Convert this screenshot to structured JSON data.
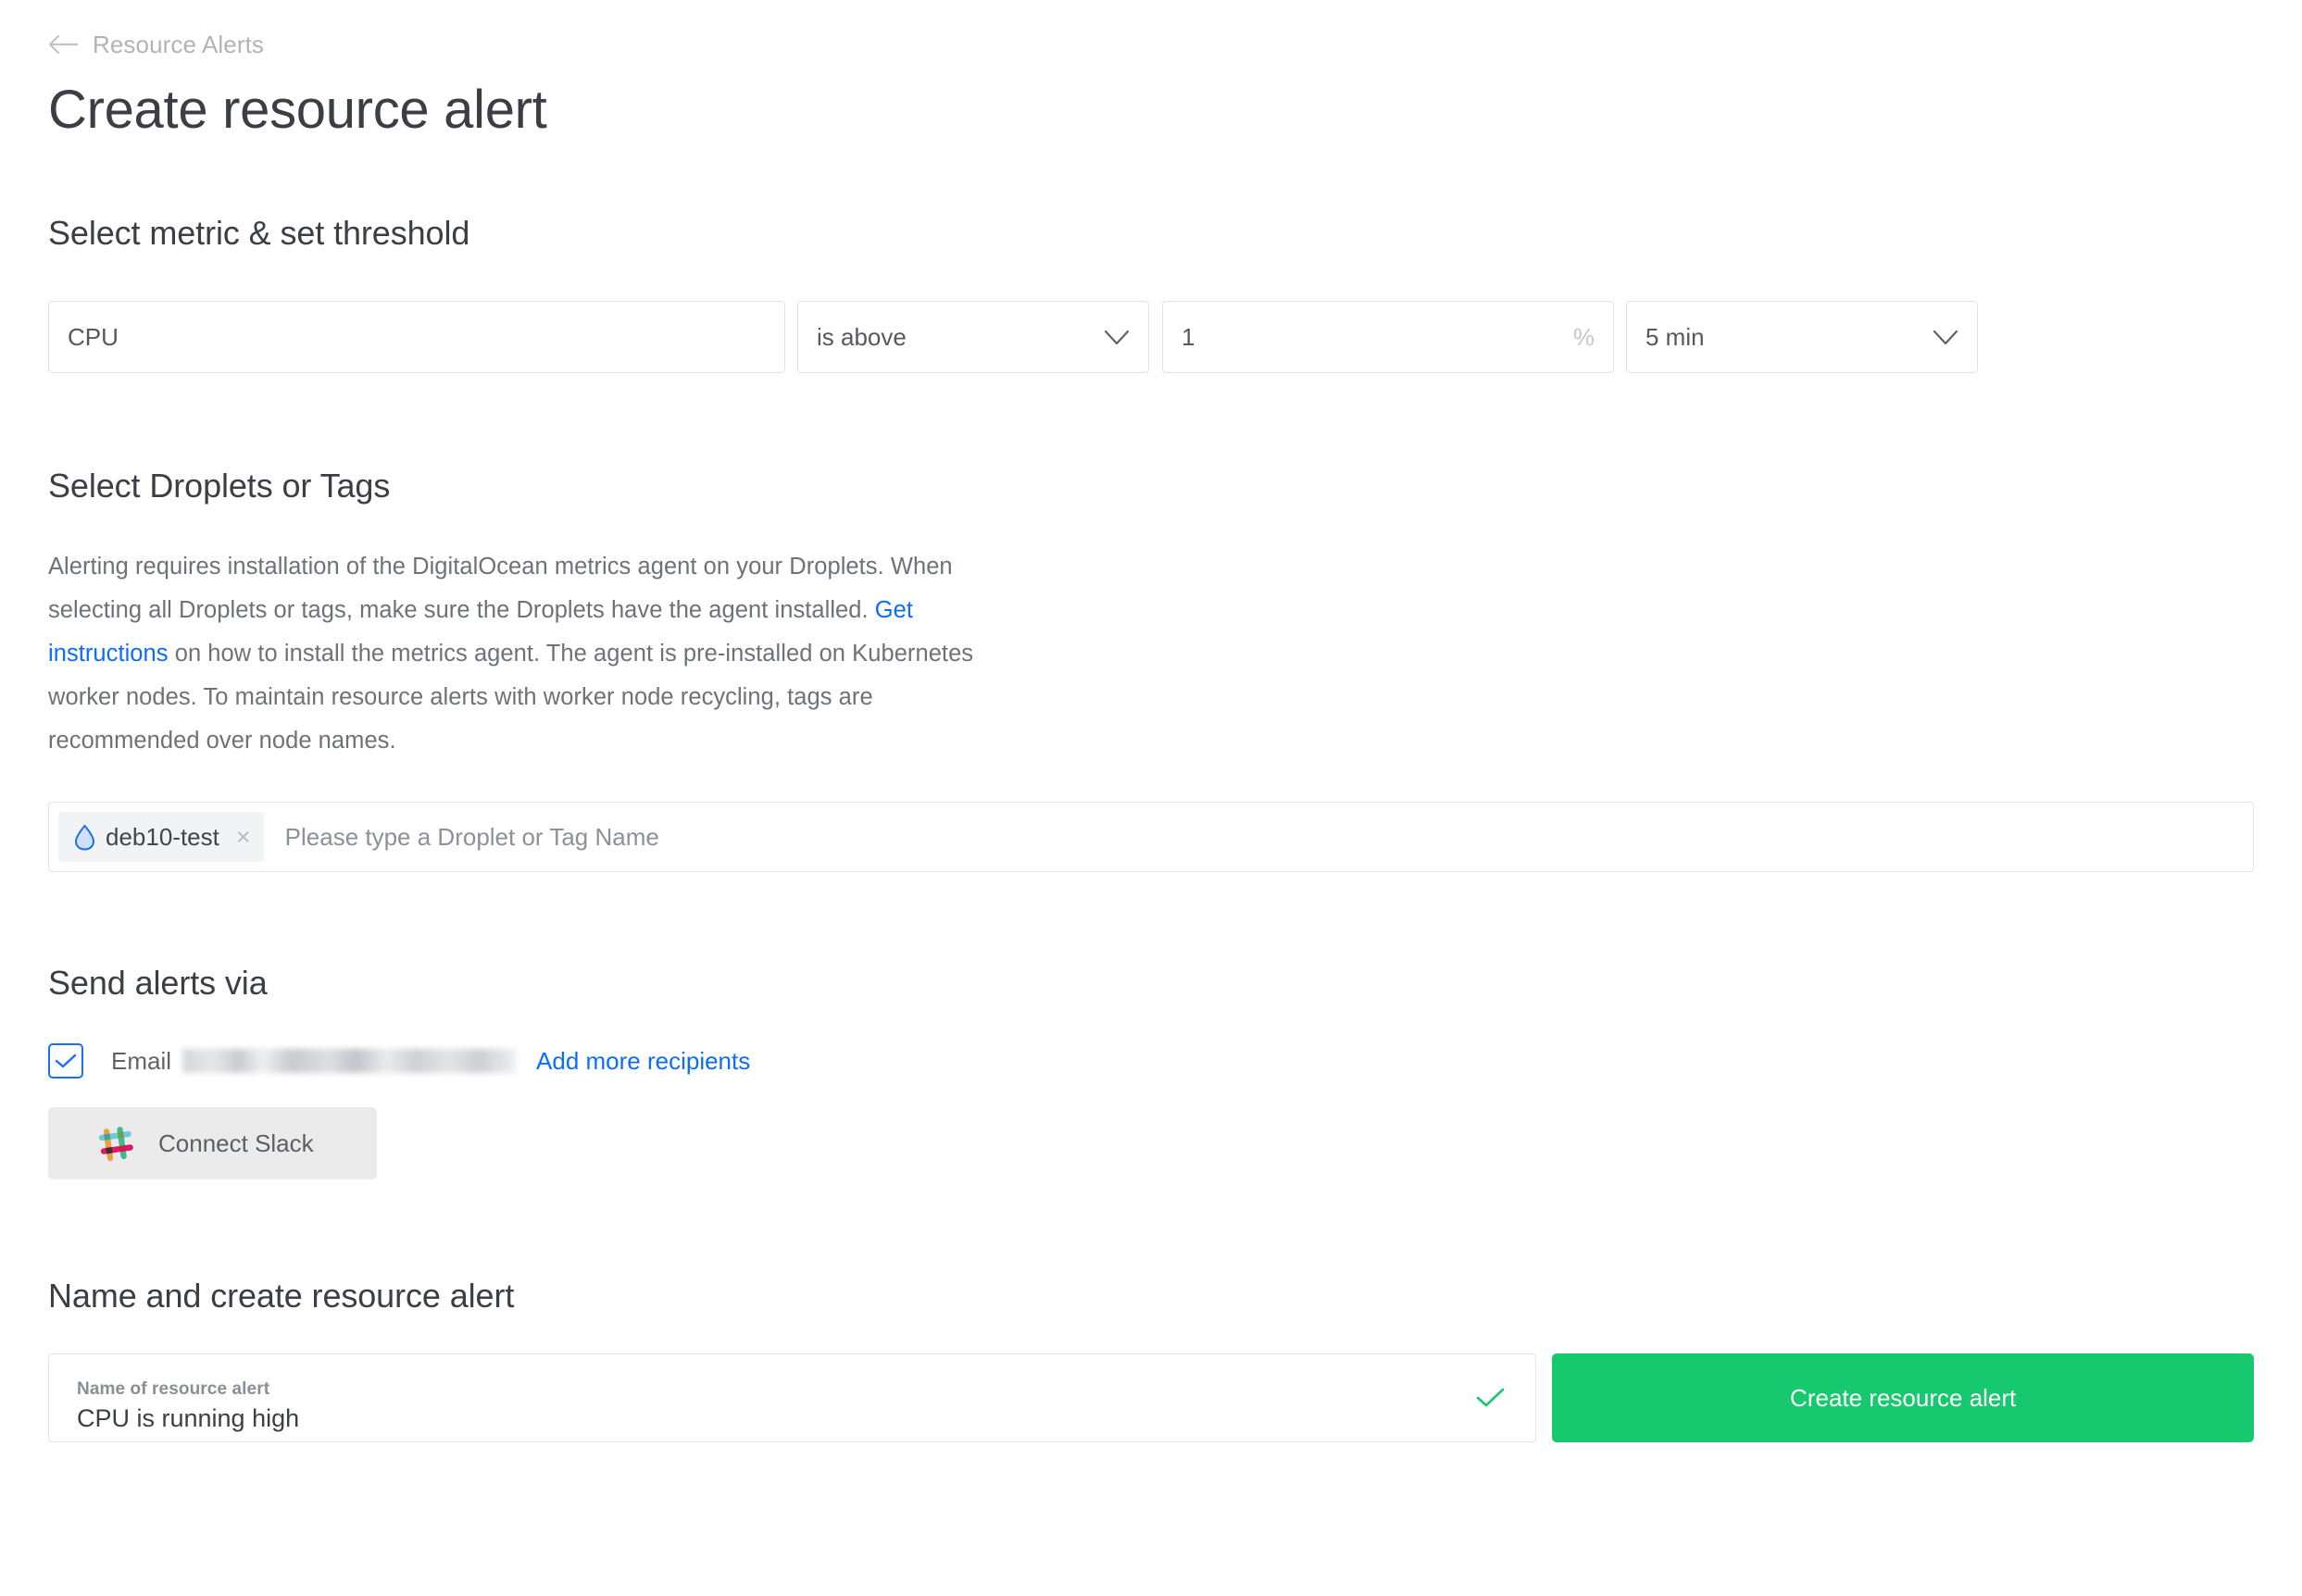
{
  "breadcrumb": {
    "back_icon": "arrow-left-icon",
    "label": "Resource Alerts"
  },
  "page_title": "Create resource alert",
  "metric_section": {
    "heading": "Select metric & set threshold",
    "metric": {
      "value": "CPU",
      "icon": "none"
    },
    "comparator": {
      "value": "is above",
      "icon": "chevron-down-icon"
    },
    "threshold": {
      "value": "1",
      "unit": "%"
    },
    "duration": {
      "value": "5 min",
      "icon": "chevron-down-icon"
    }
  },
  "droplets_section": {
    "heading": "Select Droplets or Tags",
    "help_part1": "Alerting requires installation of the DigitalOcean metrics agent on your Droplets. When selecting all Droplets or tags, make sure the Droplets have the agent installed. ",
    "help_link": "Get instructions",
    "help_part2": " on how to install the metrics agent. The agent is pre-installed on Kubernetes worker nodes. To maintain resource alerts with worker node recycling, tags are recommended over node names.",
    "chip": {
      "icon": "droplet-icon",
      "label": "deb10-test",
      "remove_icon": "×"
    },
    "placeholder": "Please type a Droplet or Tag Name"
  },
  "alerts_section": {
    "heading": "Send alerts via",
    "email_checked": true,
    "email_label": "Email",
    "email_value_redacted": "",
    "add_recipients_link": "Add more recipients",
    "slack_button_label": "Connect Slack",
    "slack_icon": "slack-icon"
  },
  "name_section": {
    "heading": "Name and create resource alert",
    "field_label": "Name of resource alert",
    "field_value": "CPU is running high",
    "valid_icon": "check-icon",
    "create_button_label": "Create resource alert"
  },
  "colors": {
    "accent_green": "#16c96e",
    "link_blue": "#0c6cff",
    "checkbox_blue": "#1a6fff",
    "text_dark": "#3b3f45",
    "text_muted": "#6d7278",
    "border": "#e1e4e8"
  }
}
